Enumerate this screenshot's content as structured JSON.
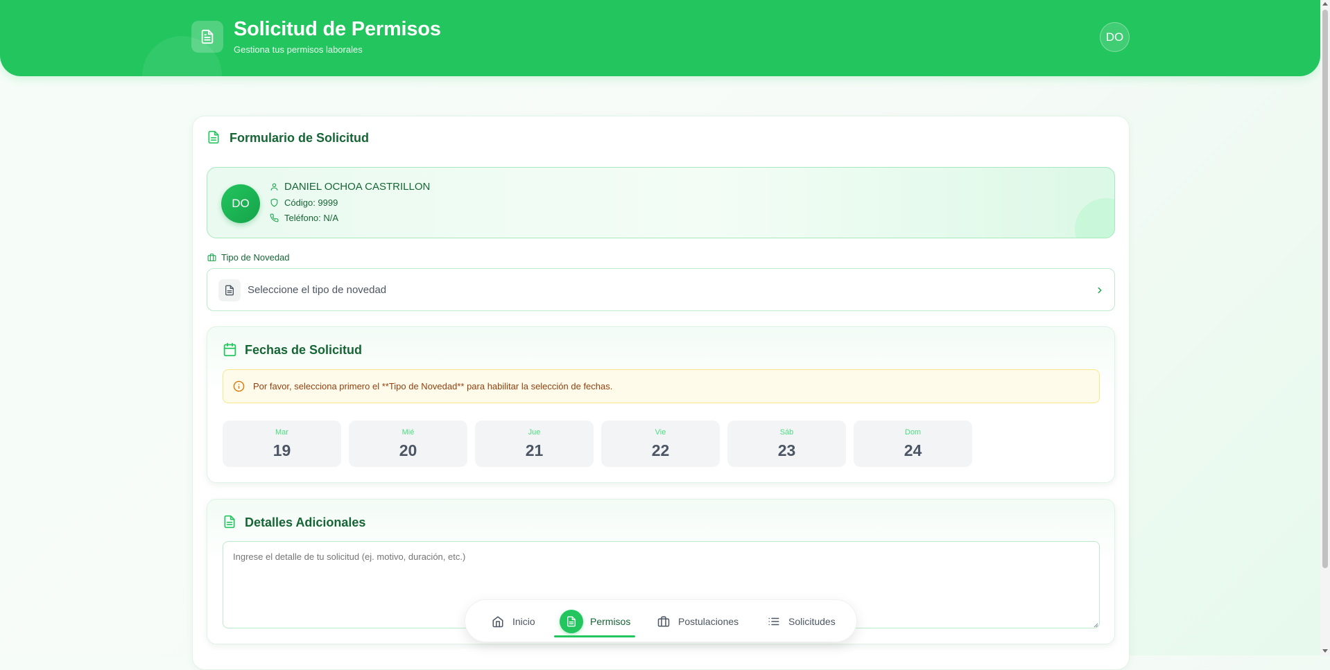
{
  "header": {
    "title": "Solicitud de Permisos",
    "subtitle": "Gestiona tus permisos laborales",
    "avatar_initials": "DO",
    "icon": "document-icon"
  },
  "form": {
    "title": "Formulario de Solicitud",
    "user": {
      "initials": "DO",
      "name": "DANIEL OCHOA CASTRILLON",
      "code": "Código: 9999",
      "phone": "Teléfono: N/A"
    },
    "novedad": {
      "label": "Tipo de Novedad",
      "placeholder": "Seleccione el tipo de novedad"
    }
  },
  "dates": {
    "title": "Fechas de Solicitud",
    "alert": "Por favor, selecciona primero el **Tipo de Novedad** para habilitar la selección de fechas.",
    "days": [
      {
        "name": "Mar",
        "num": "19"
      },
      {
        "name": "Mié",
        "num": "20"
      },
      {
        "name": "Jue",
        "num": "21"
      },
      {
        "name": "Vie",
        "num": "22"
      },
      {
        "name": "Sáb",
        "num": "23"
      },
      {
        "name": "Dom",
        "num": "24"
      }
    ]
  },
  "details": {
    "title": "Detalles Adicionales",
    "placeholder": "Ingrese el detalle de tu solicitud (ej. motivo, duración, etc.)"
  },
  "nav": {
    "items": [
      {
        "label": "Inicio",
        "icon": "home-icon"
      },
      {
        "label": "Permisos",
        "icon": "document-icon",
        "active": true
      },
      {
        "label": "Postulaciones",
        "icon": "briefcase-icon"
      },
      {
        "label": "Solicitudes",
        "icon": "list-icon"
      }
    ]
  },
  "colors": {
    "primary": "#22c55e",
    "dark_green": "#166534",
    "alert_bg": "#fffbeb",
    "alert_text": "#92400e"
  }
}
